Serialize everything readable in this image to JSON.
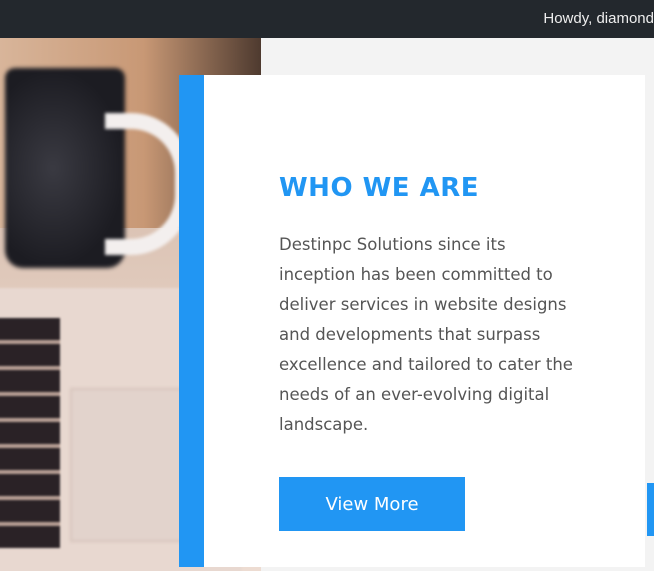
{
  "admin_bar": {
    "greeting": "Howdy, diamond"
  },
  "about_section": {
    "title": "WHO WE ARE",
    "description": "Destinpc Solutions since its inception has been committed to deliver services in website designs and developments that surpass excellence and tailored to cater the needs of an ever-evolving digital landscape.",
    "button_label": "View More"
  },
  "colors": {
    "accent": "#2196f3",
    "admin_bar_bg": "#23282d",
    "body_text": "#555555",
    "page_bg": "#f3f3f3"
  }
}
